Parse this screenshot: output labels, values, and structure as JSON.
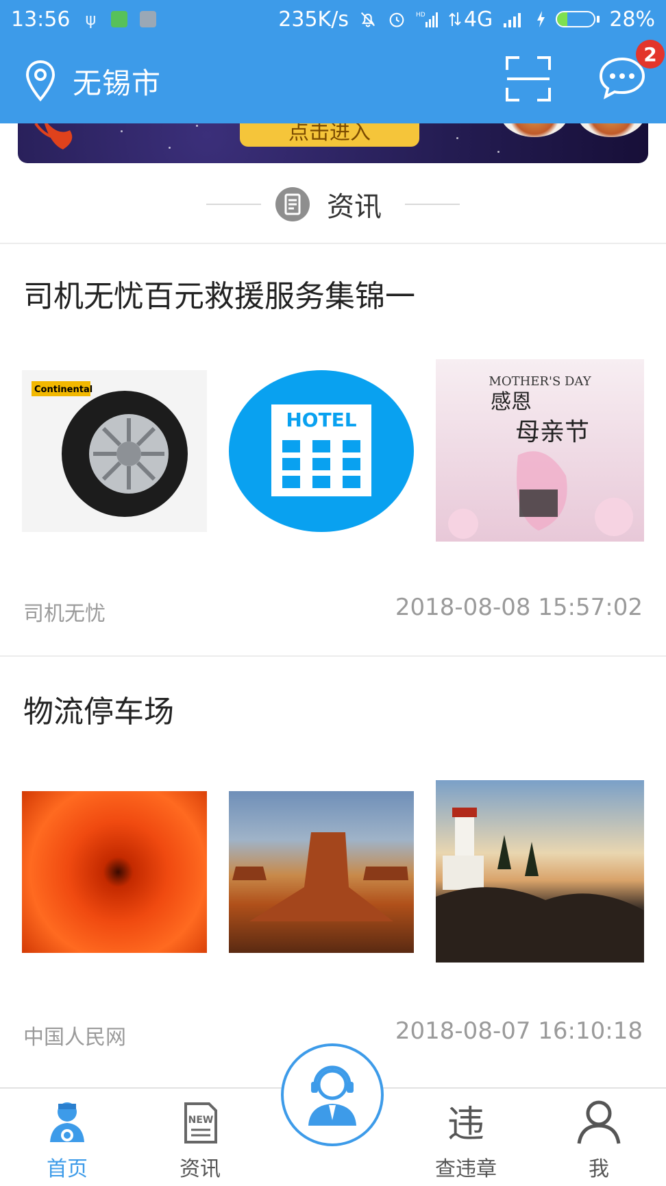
{
  "status_bar": {
    "time": "13:56",
    "network_speed": "235K/s",
    "network_type": "4G",
    "battery": "28%",
    "battery_level": 0.28
  },
  "header": {
    "city": "无锡市",
    "message_badge": "2"
  },
  "section": {
    "title": "资讯"
  },
  "news": [
    {
      "title": "司机无忧百元救援服务集锦一",
      "source": "司机无忧",
      "time": "2018-08-08 15:57:02",
      "images": [
        "continental-tire",
        "hotel-icon",
        "mothers-day-poster"
      ]
    },
    {
      "title": "物流停车场",
      "source": "中国人民网",
      "time": "2018-08-07 16:10:18",
      "images": [
        "orange-chrysanthemum",
        "desert-butte",
        "lighthouse-coast"
      ]
    }
  ],
  "banner": {
    "button_text": "点击进入"
  },
  "thumb_text": {
    "tire_brand": "Continental",
    "hotel": "HOTEL",
    "poster_en": "MOTHER'S DAY",
    "poster_line1": "感恩",
    "poster_line2": "母亲节"
  },
  "bottom_nav": {
    "items": [
      {
        "label": "首页",
        "icon": "home-mascot-icon",
        "active": true
      },
      {
        "label": "资讯",
        "icon": "news-icon",
        "active": false
      },
      {
        "label": "",
        "icon": "customer-service-icon",
        "active": false
      },
      {
        "label": "查违章",
        "icon": "violation-icon",
        "active": false
      },
      {
        "label": "我",
        "icon": "profile-icon",
        "active": false
      }
    ]
  },
  "colors": {
    "brand_blue": "#3d9be9",
    "badge_red": "#e3352b",
    "muted_text": "#9a9a9a"
  }
}
